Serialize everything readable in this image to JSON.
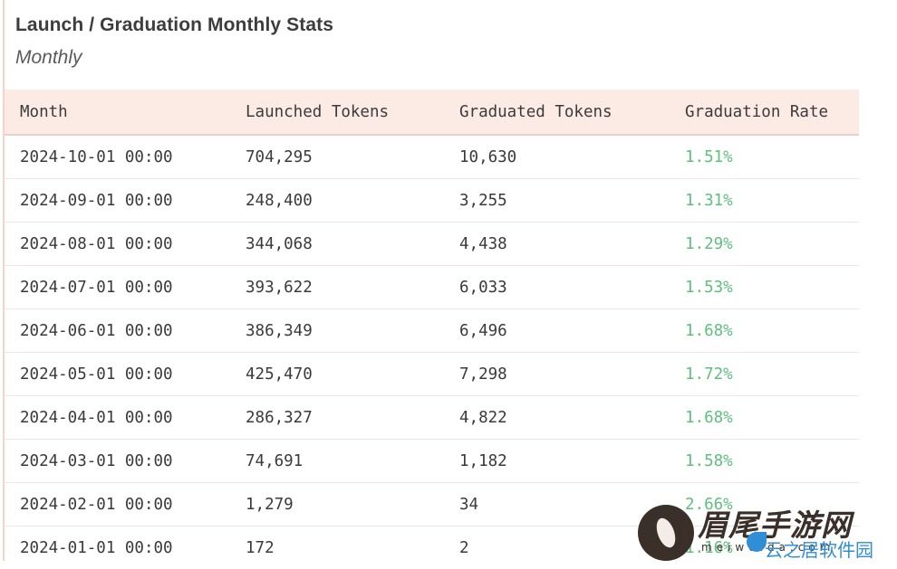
{
  "panel": {
    "title": "Launch / Graduation Monthly Stats",
    "subtitle": "Monthly"
  },
  "table": {
    "headers": [
      "Month",
      "Launched Tokens",
      "Graduated Tokens",
      "Graduation Rate"
    ],
    "rows": [
      [
        "2024-10-01 00:00",
        "704,295",
        "10,630",
        "1.51%"
      ],
      [
        "2024-09-01 00:00",
        "248,400",
        "3,255",
        "1.31%"
      ],
      [
        "2024-08-01 00:00",
        "344,068",
        "4,438",
        "1.29%"
      ],
      [
        "2024-07-01 00:00",
        "393,622",
        "6,033",
        "1.53%"
      ],
      [
        "2024-06-01 00:00",
        "386,349",
        "6,496",
        "1.68%"
      ],
      [
        "2024-05-01 00:00",
        "425,470",
        "7,298",
        "1.72%"
      ],
      [
        "2024-04-01 00:00",
        "286,327",
        "4,822",
        "1.68%"
      ],
      [
        "2024-03-01 00:00",
        "74,691",
        "1,182",
        "1.58%"
      ],
      [
        "2024-02-01 00:00",
        "1,279",
        "34",
        "2.66%"
      ],
      [
        "2024-01-01 00:00",
        "172",
        "2",
        "1.16%"
      ]
    ]
  },
  "colors": {
    "header_bg": "#fcebe5",
    "rate_green": "#5fbf7d",
    "accent_border": "#f6d4c9"
  },
  "watermark": {
    "line1": "眉尾手游网",
    "line2": "meiweida.com",
    "line3": "云之居软件园",
    "icon": "leaf-logo-icon"
  }
}
